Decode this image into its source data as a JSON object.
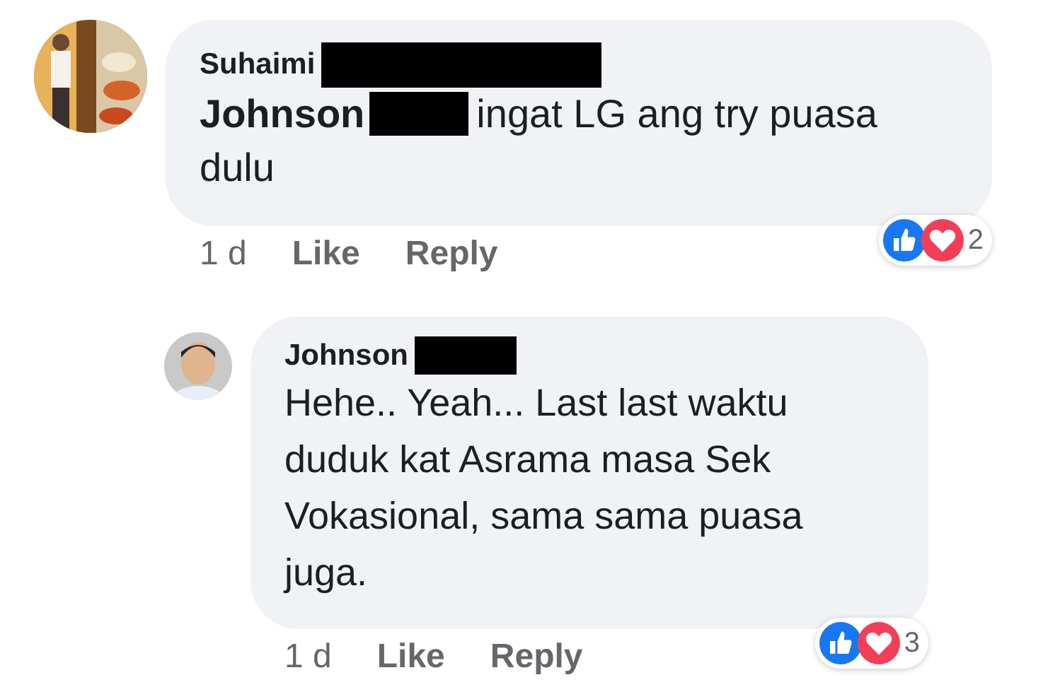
{
  "comments": [
    {
      "author": {
        "name": "Suhaimi",
        "redacted": true
      },
      "mention": {
        "name": "Johnson",
        "redacted": true
      },
      "lines": [
        "ingat LG ang try puasa",
        "dulu"
      ],
      "time": "1 d",
      "like": "Like",
      "reply": "Reply",
      "reactions": {
        "like": true,
        "love": true,
        "count": "2"
      }
    },
    {
      "author": {
        "name": "Johnson",
        "redacted": true
      },
      "lines": [
        "Hehe.. Yeah... Last last waktu",
        "duduk kat Asrama masa Sek",
        "Vokasional, sama sama puasa",
        "juga."
      ],
      "time": "1 d",
      "like": "Like",
      "reply": "Reply",
      "reactions": {
        "like": true,
        "love": true,
        "count": "3"
      }
    }
  ]
}
